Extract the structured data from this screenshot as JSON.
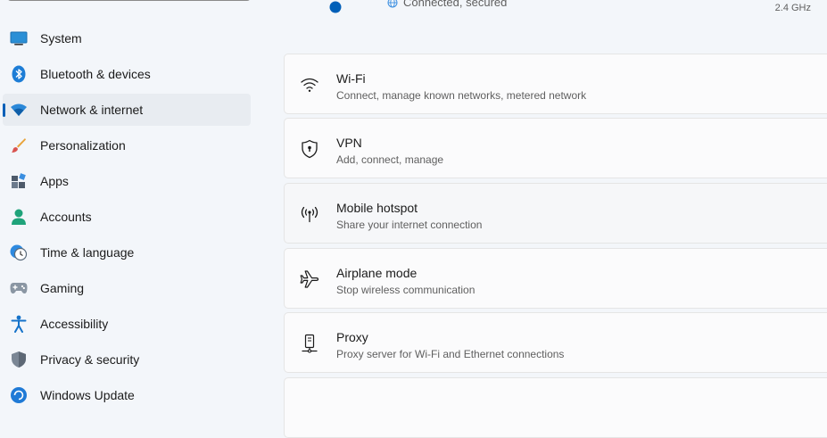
{
  "sidebar": {
    "items": [
      {
        "label": "System",
        "icon": "monitor-icon",
        "selected": false
      },
      {
        "label": "Bluetooth & devices",
        "icon": "bluetooth-icon",
        "selected": false
      },
      {
        "label": "Network & internet",
        "icon": "wifi-icon",
        "selected": true
      },
      {
        "label": "Personalization",
        "icon": "brush-icon",
        "selected": false
      },
      {
        "label": "Apps",
        "icon": "apps-icon",
        "selected": false
      },
      {
        "label": "Accounts",
        "icon": "person-icon",
        "selected": false
      },
      {
        "label": "Time & language",
        "icon": "clock-globe-icon",
        "selected": false
      },
      {
        "label": "Gaming",
        "icon": "gamepad-icon",
        "selected": false
      },
      {
        "label": "Accessibility",
        "icon": "accessibility-icon",
        "selected": false
      },
      {
        "label": "Privacy & security",
        "icon": "shield-icon",
        "selected": false
      },
      {
        "label": "Windows Update",
        "icon": "update-icon",
        "selected": false
      }
    ]
  },
  "status": {
    "connection_text": "Connected, secured",
    "band": "2.4 GHz"
  },
  "cards": [
    {
      "title": "Wi-Fi",
      "subtitle": "Connect, manage known networks, metered network",
      "icon": "wifi-icon"
    },
    {
      "title": "VPN",
      "subtitle": "Add, connect, manage",
      "icon": "vpn-shield-icon"
    },
    {
      "title": "Mobile hotspot",
      "subtitle": "Share your internet connection",
      "icon": "hotspot-icon"
    },
    {
      "title": "Airplane mode",
      "subtitle": "Stop wireless communication",
      "icon": "airplane-icon"
    },
    {
      "title": "Proxy",
      "subtitle": "Proxy server for Wi-Fi and Ethernet connections",
      "icon": "proxy-icon"
    }
  ],
  "colors": {
    "accent": "#005fb8",
    "background": "#f3f6fa",
    "card": "#fbfbfc"
  }
}
